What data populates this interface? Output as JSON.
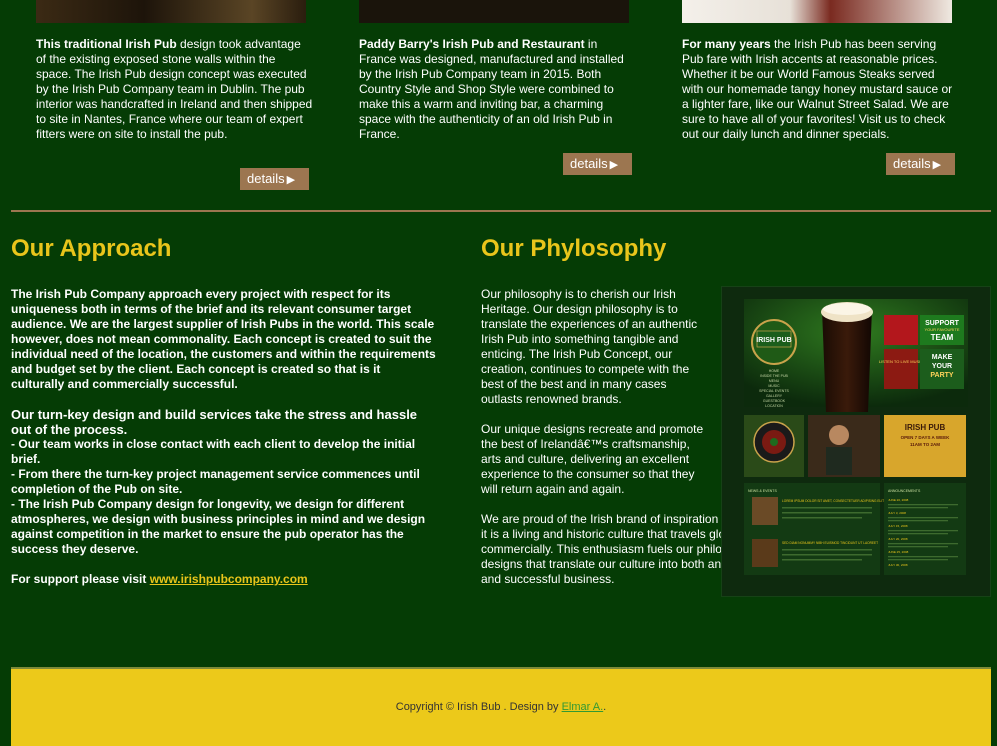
{
  "columns": [
    {
      "lead": "This traditional Irish Pub",
      "body": " design took advantage of the existing exposed stone walls within the space. The Irish Pub design concept was executed by the Irish Pub Company team in Dublin. The pub interior was handcrafted in Ireland and then shipped to site in Nantes, France where our team of expert fitters were on site to install the pub.",
      "details_label": "details"
    },
    {
      "lead": "Paddy Barry's Irish Pub and Restaurant",
      "body": " in France was designed, manufactured and installed by the Irish Pub Company team in 2015. Both Country Style and Shop Style were combined to make this a warm and inviting bar, a charming space with the authenticity of an old Irish Pub in France.",
      "details_label": "details"
    },
    {
      "lead": "For many years",
      "body": " the Irish Pub has been serving Pub fare with Irish accents at reasonable prices. Whether it be our World Famous Steaks served with our homemade tangy honey mustard sauce or a lighter fare, like our Walnut Street Salad. We are sure to have all of your favorites! Visit us to check out our daily lunch and dinner specials.",
      "details_label": "details"
    }
  ],
  "approach": {
    "heading": "Our Approach",
    "p1": "The Irish Pub Company approach every project with respect for its uniqueness both in terms of the brief and its relevant consumer target audience. We are the largest supplier of Irish Pubs in the world. This scale however, does not mean commonality. Each concept is created to suit the individual need of the location, the customers and within the requirements and budget set by the client. Each concept is created so that is it culturally and commercially successful.",
    "sub": "Our turn-key design and build services take the stress and hassle out of the process.",
    "b1": "- Our team works in close contact with each client to develop the initial brief.",
    "b2": "- From there the turn-key project management service commences until completion of the Pub on site.",
    "b3": "- The Irish Pub Company design for longevity, we design for different atmospheres, we design with business principles in mind and we design against competition in the market to ensure the pub operator has the success they deserve.",
    "support": "For support please visit ",
    "link": "www.irishpubcompany.com"
  },
  "philosophy": {
    "heading": "Our Phylosophy",
    "p1": "Our philosophy is to cherish our Irish Heritage. Our design philosophy is to translate the experiences of an authentic Irish Pub into something tangible and enticing. The Irish Pub Concept, our creation, continues to compete with the best of the best and in many cases outlasts renowned brands.",
    "p2": "Our unique designs recreate and promote the best of Irelandâ€™s craftsmanship, arts and culture, delivering an excellent experience to the consumer so that they will return again and again.",
    "p3": "We are proud of the Irish brand of inspiration and engagement. To us it is a living and historic culture that travels globally, both socially and commercially. This enthusiasm fuels our philosophy to offer unique designs that translate our culture into both an authentic experience and successful business."
  },
  "screenshot": {
    "logo": "IRISH PUB",
    "nav": [
      "HOME",
      "INSIDE THE PUB",
      "MENU",
      "MUSIC",
      "SPECIAL EVENTS",
      "GALLERY",
      "GUESTBOOK",
      "LOCATION"
    ],
    "banner1": "SUPPORT",
    "banner2": "YOUR FAVOURITE",
    "banner3": "TEAM",
    "banner4": "MAKE",
    "banner5": "YOUR",
    "banner6": "PARTY",
    "live": "LISTEN TO LIVE MUSIC",
    "promo_title": "IRISH PUB",
    "promo_hours": "OPEN 7 DAYS A WEEK",
    "promo_time": "11AM TO 2AM",
    "news": "NEWS & EVENTS",
    "announce": "ANNOUNCEMENTS",
    "news1": "LOREM IPSUM DOLOR SIT AMET, CONSECTETUER ADIPISING ELIT",
    "news2": "SED DIAM NONUMMY NIBH EUISMOD TINCIDUNT UT LAOREET",
    "dates": [
      "JUNE 20, 2008",
      "JULY 3, 2008",
      "JULY 15, 2008",
      "JULY 20, 2008",
      "JUNE 25, 2008",
      "JULY 30, 2008"
    ]
  },
  "footer": {
    "text": "Copyright © Irish Bub . Design by ",
    "author": "Elmar A.",
    "end": "."
  },
  "colors": {
    "background": "#053c05",
    "heading": "#e9c51b",
    "button": "#9c7650",
    "footer": "#ecc91a"
  }
}
